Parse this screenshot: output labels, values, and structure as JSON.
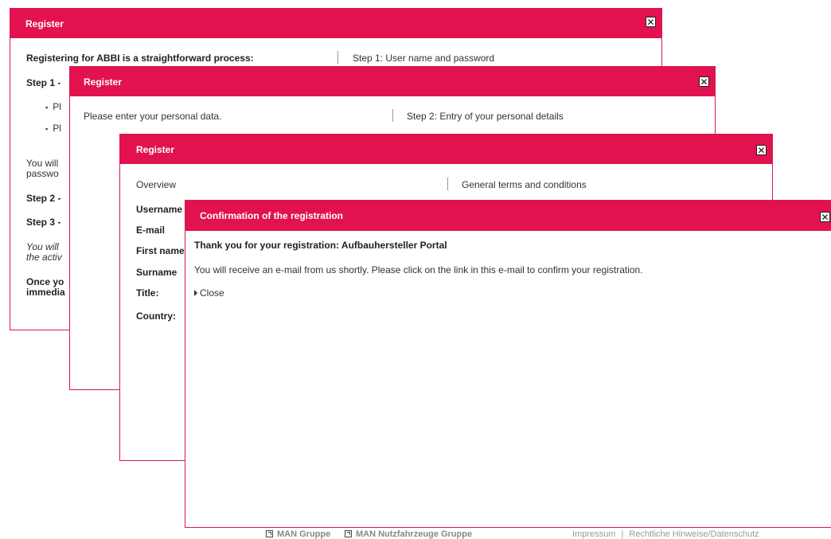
{
  "dialog1": {
    "title": "Register",
    "intro": "Registering for ABBI is a straightforward process:",
    "step_header": "Step 1: User name and password",
    "step1": "Step 1 -",
    "bullet1": "Pl",
    "bullet2": "Pl",
    "text_a1": "You will",
    "text_a2": "passwo",
    "step2": "Step 2 -",
    "step3": "Step 3 -",
    "italic1": "You will",
    "italic2": "the activ",
    "bold1": "Once yo",
    "bold2": "immedia"
  },
  "dialog2": {
    "title": "Register",
    "intro": "Please enter your personal data.",
    "step_header": "Step 2: Entry of your personal details"
  },
  "dialog3": {
    "title": "Register",
    "overview": "Overview",
    "terms_header": "General terms and conditions",
    "fields": [
      "Username",
      "E-mail",
      "First name",
      "Surname",
      "Title:",
      "Country:"
    ]
  },
  "dialog4": {
    "title": "Confirmation of the registration",
    "thanks": "Thank you for your registration: Aufbauhersteller Portal",
    "message": "You will receive an e-mail from us shortly. Please click on the link in this e-mail to confirm your registration.",
    "close_link": "Close"
  },
  "close_icon_glyph": "✕",
  "footer": {
    "link1": "MAN Gruppe",
    "link2": "MAN Nutzfahrzeuge Gruppe",
    "impressum": "Impressum",
    "separator": "|",
    "legal": "Rechtliche Hinweise/Datenschutz"
  },
  "colors": {
    "accent": "#e2124f",
    "border": "#d8174a"
  }
}
